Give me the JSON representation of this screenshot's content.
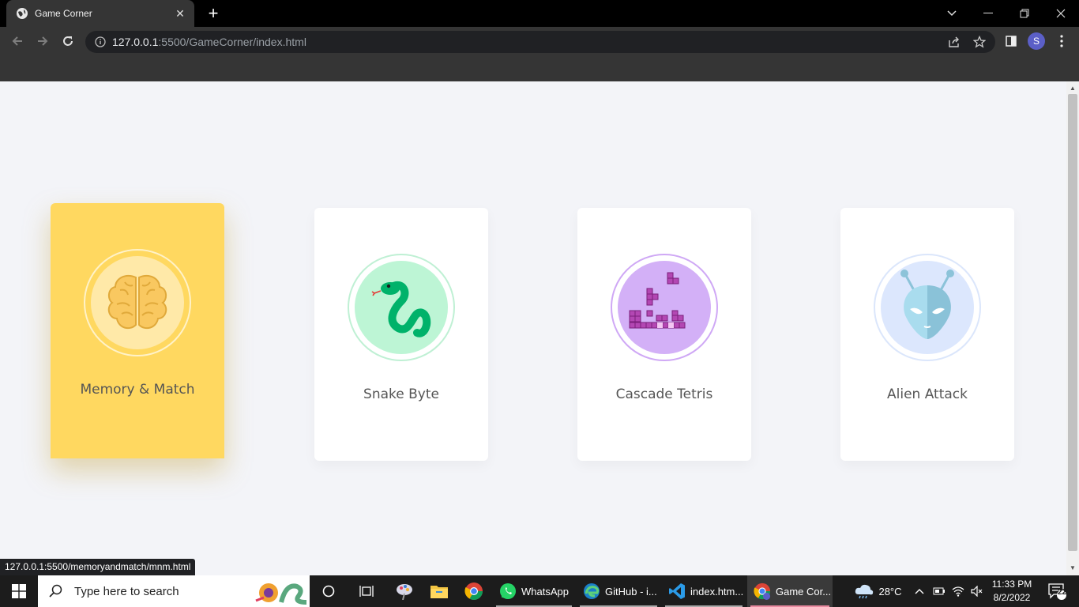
{
  "browser": {
    "tab_title": "Game Corner",
    "url_host": "127.0.0.1",
    "url_rest": ":5500/GameCorner/index.html",
    "profile_initial": "S"
  },
  "games": [
    {
      "name": "Memory & Match",
      "icon": "brain-icon",
      "ring": "#fff3c4",
      "bg": "#ffe9a8"
    },
    {
      "name": "Snake Byte",
      "icon": "snake-icon",
      "ring": "#bff0d4",
      "bg": "#bdf5d5"
    },
    {
      "name": "Cascade Tetris",
      "icon": "tetris-blocks-icon",
      "ring": "#cfa8f5",
      "bg": "#d3b0f7"
    },
    {
      "name": "Alien Attack",
      "icon": "alien-icon",
      "ring": "#dbe6fb",
      "bg": "#dce7fd"
    }
  ],
  "status_url": "127.0.0.1:5500/memoryandmatch/mnm.html",
  "taskbar": {
    "search_placeholder": "Type here to search",
    "apps": [
      {
        "label": "WhatsApp"
      },
      {
        "label": "GitHub - i..."
      },
      {
        "label": "index.htm..."
      },
      {
        "label": "Game Cor..."
      }
    ],
    "temperature": "28°C",
    "time": "11:33 PM",
    "date": "8/2/2022",
    "notifications": "22"
  }
}
